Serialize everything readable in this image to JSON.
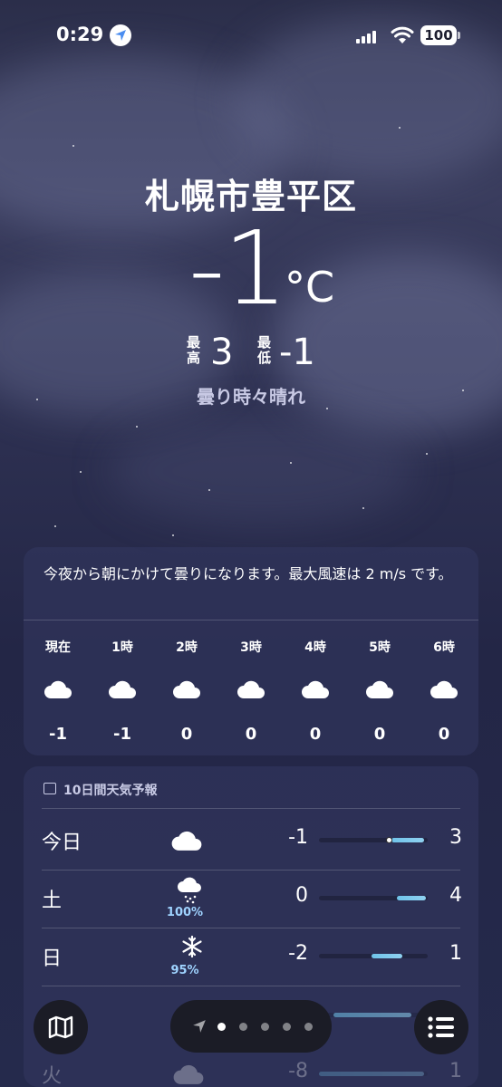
{
  "status": {
    "time": "0:29",
    "battery": "100"
  },
  "location": {
    "city": "札幌市豊平区"
  },
  "current": {
    "temp": "-1",
    "unit": "°C",
    "high_label": "最高",
    "high": "3",
    "low_label": "最低",
    "low": "-1",
    "condition": "曇り時々晴れ"
  },
  "hourly": {
    "summary": "今夜から朝にかけて曇りになります。最大風速は 2 m/s です。",
    "hours": [
      {
        "label": "現在",
        "icon": "cloud-icon",
        "temp": "-1"
      },
      {
        "label": "1時",
        "icon": "cloud-icon",
        "temp": "-1"
      },
      {
        "label": "2時",
        "icon": "cloud-icon",
        "temp": "0"
      },
      {
        "label": "3時",
        "icon": "cloud-icon",
        "temp": "0"
      },
      {
        "label": "4時",
        "icon": "cloud-icon",
        "temp": "0"
      },
      {
        "label": "5時",
        "icon": "cloud-icon",
        "temp": "0"
      },
      {
        "label": "6時",
        "icon": "cloud-icon",
        "temp": "0"
      }
    ]
  },
  "forecast": {
    "title": "10日間天気予報",
    "days": [
      {
        "day": "今日",
        "icon": "cloud-icon",
        "precip": "",
        "low": "-1",
        "high": "3"
      },
      {
        "day": "土",
        "icon": "cloud-snow-icon",
        "precip": "100%",
        "low": "0",
        "high": "4"
      },
      {
        "day": "日",
        "icon": "snowflake-icon",
        "precip": "95%",
        "low": "-2",
        "high": "1"
      },
      {
        "day": "火",
        "icon": "cloud-icon",
        "precip": "",
        "low": "-8",
        "high": "1"
      }
    ]
  },
  "colors": {
    "accent_bar": "#7cc8ee",
    "background": "#2b2e4a",
    "card": "#30345c"
  }
}
